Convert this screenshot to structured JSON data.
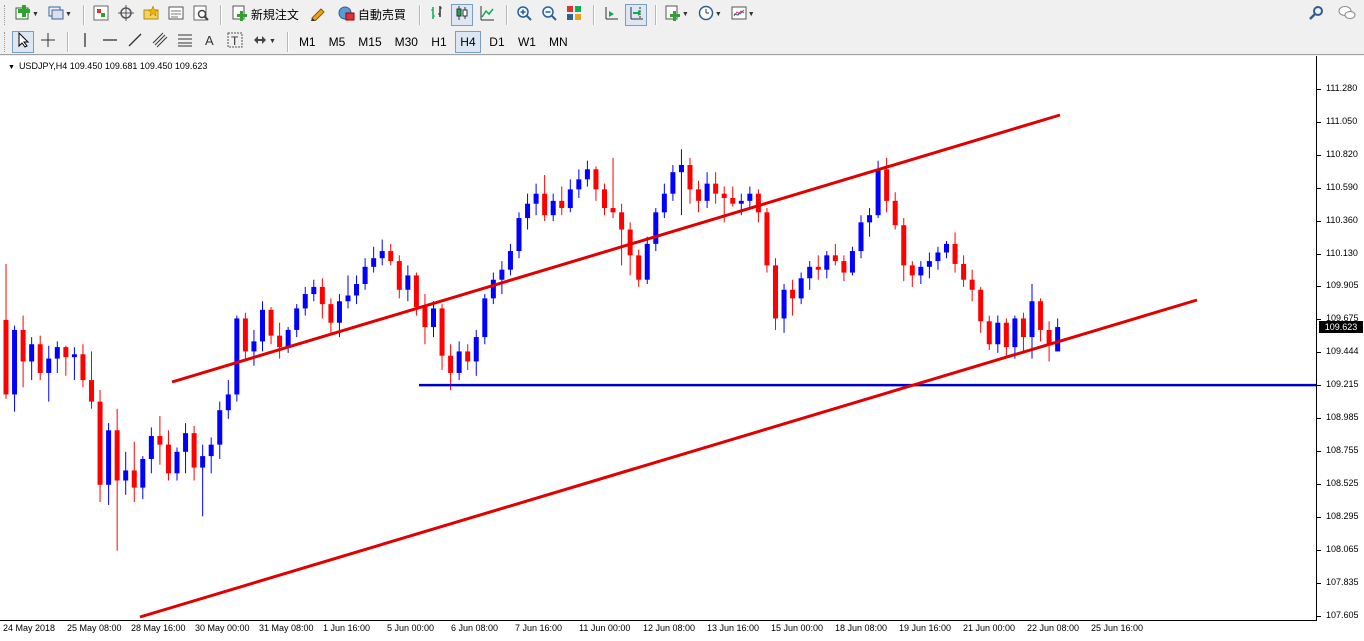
{
  "toolbar_main": {
    "new_order_label": "新規注文",
    "auto_trade_label": "自動売買"
  },
  "toolbar_timeframes": [
    "M1",
    "M5",
    "M15",
    "M30",
    "H1",
    "H4",
    "D1",
    "W1",
    "MN"
  ],
  "active_timeframe": "H4",
  "chart": {
    "header": "USDJPY,H4  109.450 109.681 109.450 109.623",
    "current_price": "109.623",
    "colors": {
      "bull": "#0000ff",
      "bear": "#ff0000",
      "channel": "#e00000",
      "support": "#0000cc"
    }
  },
  "chart_data": {
    "type": "candlestick",
    "symbol": "USDJPY",
    "timeframe": "H4",
    "ohlc_last": {
      "open": 109.45,
      "high": 109.681,
      "low": 109.45,
      "close": 109.623
    },
    "y_ticks": [
      "111.280",
      "111.050",
      "110.820",
      "110.590",
      "110.360",
      "110.130",
      "109.905",
      "109.675",
      "109.444",
      "109.215",
      "108.985",
      "108.755",
      "108.525",
      "108.295",
      "108.065",
      "107.835",
      "107.605"
    ],
    "x_ticks": [
      "24 May 2018",
      "25 May 08:00",
      "28 May 16:00",
      "30 May 00:00",
      "31 May 08:00",
      "1 Jun 16:00",
      "5 Jun 00:00",
      "6 Jun 08:00",
      "7 Jun 16:00",
      "11 Jun 00:00",
      "12 Jun 08:00",
      "13 Jun 16:00",
      "15 Jun 00:00",
      "18 Jun 08:00",
      "19 Jun 16:00",
      "21 Jun 00:00",
      "22 Jun 08:00",
      "25 Jun 16:00"
    ],
    "ylim": [
      107.55,
      111.45
    ],
    "horizontal_support": 109.215,
    "channel_upper": {
      "from": [
        "28 May 16:00",
        109.65
      ],
      "to": [
        "13 Jun 16:00 +",
        111.35
      ]
    },
    "channel_lower": {
      "from": [
        "28 May 16:00",
        108.0
      ],
      "to": [
        "25 Jun 16:00 +",
        110.15
      ]
    },
    "candles": [
      [
        109.67,
        110.06,
        109.12,
        109.15
      ],
      [
        109.15,
        109.63,
        109.03,
        109.6
      ],
      [
        109.6,
        109.7,
        109.2,
        109.38
      ],
      [
        109.38,
        109.55,
        109.25,
        109.5
      ],
      [
        109.5,
        109.56,
        109.25,
        109.3
      ],
      [
        109.3,
        109.49,
        109.1,
        109.4
      ],
      [
        109.4,
        109.52,
        109.3,
        109.48
      ],
      [
        109.48,
        109.49,
        109.28,
        109.41
      ],
      [
        109.41,
        109.48,
        109.25,
        109.43
      ],
      [
        109.43,
        109.5,
        109.2,
        109.25
      ],
      [
        109.25,
        109.45,
        109.05,
        109.1
      ],
      [
        109.1,
        109.18,
        108.4,
        108.52
      ],
      [
        108.52,
        108.95,
        108.38,
        108.9
      ],
      [
        108.9,
        109.05,
        108.06,
        108.55
      ],
      [
        108.55,
        108.75,
        108.45,
        108.62
      ],
      [
        108.62,
        108.82,
        108.4,
        108.5
      ],
      [
        108.5,
        108.72,
        108.42,
        108.7
      ],
      [
        108.7,
        108.92,
        108.6,
        108.86
      ],
      [
        108.86,
        109.0,
        108.66,
        108.8
      ],
      [
        108.8,
        108.9,
        108.55,
        108.6
      ],
      [
        108.6,
        108.78,
        108.55,
        108.75
      ],
      [
        108.75,
        108.95,
        108.6,
        108.88
      ],
      [
        108.88,
        108.93,
        108.55,
        108.64
      ],
      [
        108.64,
        108.8,
        108.3,
        108.72
      ],
      [
        108.72,
        108.85,
        108.6,
        108.8
      ],
      [
        108.8,
        109.1,
        108.7,
        109.04
      ],
      [
        109.04,
        109.25,
        108.98,
        109.15
      ],
      [
        109.15,
        109.7,
        109.1,
        109.68
      ],
      [
        109.68,
        109.72,
        109.38,
        109.45
      ],
      [
        109.45,
        109.6,
        109.35,
        109.52
      ],
      [
        109.52,
        109.8,
        109.45,
        109.74
      ],
      [
        109.74,
        109.76,
        109.5,
        109.56
      ],
      [
        109.56,
        109.65,
        109.4,
        109.48
      ],
      [
        109.48,
        109.62,
        109.44,
        109.6
      ],
      [
        109.6,
        109.78,
        109.55,
        109.75
      ],
      [
        109.75,
        109.9,
        109.7,
        109.85
      ],
      [
        109.85,
        109.95,
        109.8,
        109.9
      ],
      [
        109.9,
        109.96,
        109.68,
        109.78
      ],
      [
        109.78,
        109.82,
        109.58,
        109.65
      ],
      [
        109.65,
        109.85,
        109.55,
        109.8
      ],
      [
        109.8,
        109.98,
        109.75,
        109.84
      ],
      [
        109.84,
        109.98,
        109.78,
        109.92
      ],
      [
        109.92,
        110.1,
        109.88,
        110.04
      ],
      [
        110.04,
        110.18,
        110.0,
        110.1
      ],
      [
        110.1,
        110.23,
        110.05,
        110.15
      ],
      [
        110.15,
        110.2,
        110.05,
        110.08
      ],
      [
        110.08,
        110.12,
        109.82,
        109.88
      ],
      [
        109.88,
        110.05,
        109.8,
        109.98
      ],
      [
        109.98,
        110.0,
        109.7,
        109.76
      ],
      [
        109.76,
        109.85,
        109.5,
        109.62
      ],
      [
        109.62,
        109.8,
        109.55,
        109.75
      ],
      [
        109.75,
        109.78,
        109.32,
        109.42
      ],
      [
        109.42,
        109.5,
        109.18,
        109.3
      ],
      [
        109.3,
        109.52,
        109.25,
        109.45
      ],
      [
        109.45,
        109.5,
        109.32,
        109.38
      ],
      [
        109.38,
        109.6,
        109.28,
        109.55
      ],
      [
        109.55,
        109.85,
        109.5,
        109.82
      ],
      [
        109.82,
        110.0,
        109.78,
        109.95
      ],
      [
        109.95,
        110.08,
        109.85,
        110.02
      ],
      [
        110.02,
        110.2,
        109.98,
        110.15
      ],
      [
        110.15,
        110.42,
        110.1,
        110.38
      ],
      [
        110.38,
        110.55,
        110.3,
        110.48
      ],
      [
        110.48,
        110.62,
        110.4,
        110.55
      ],
      [
        110.55,
        110.68,
        110.36,
        110.4
      ],
      [
        110.4,
        110.55,
        110.36,
        110.5
      ],
      [
        110.5,
        110.6,
        110.4,
        110.45
      ],
      [
        110.45,
        110.65,
        110.42,
        110.58
      ],
      [
        110.58,
        110.72,
        110.52,
        110.65
      ],
      [
        110.65,
        110.78,
        110.6,
        110.72
      ],
      [
        110.72,
        110.74,
        110.5,
        110.58
      ],
      [
        110.58,
        110.62,
        110.4,
        110.45
      ],
      [
        110.45,
        110.8,
        110.38,
        110.42
      ],
      [
        110.42,
        110.48,
        110.05,
        110.3
      ],
      [
        110.3,
        110.35,
        109.98,
        110.12
      ],
      [
        110.12,
        110.16,
        109.9,
        109.95
      ],
      [
        109.95,
        110.25,
        109.92,
        110.2
      ],
      [
        110.2,
        110.45,
        110.15,
        110.42
      ],
      [
        110.42,
        110.62,
        110.38,
        110.55
      ],
      [
        110.55,
        110.75,
        110.5,
        110.7
      ],
      [
        110.7,
        110.86,
        110.4,
        110.75
      ],
      [
        110.75,
        110.8,
        110.48,
        110.58
      ],
      [
        110.58,
        110.64,
        110.42,
        110.5
      ],
      [
        110.5,
        110.7,
        110.45,
        110.62
      ],
      [
        110.62,
        110.7,
        110.48,
        110.55
      ],
      [
        110.55,
        110.6,
        110.35,
        110.52
      ],
      [
        110.52,
        110.6,
        110.46,
        110.48
      ],
      [
        110.48,
        110.55,
        110.4,
        110.5
      ],
      [
        110.5,
        110.6,
        110.45,
        110.55
      ],
      [
        110.55,
        110.58,
        110.35,
        110.42
      ],
      [
        110.42,
        110.45,
        110.0,
        110.05
      ],
      [
        110.05,
        110.1,
        109.6,
        109.68
      ],
      [
        109.68,
        109.92,
        109.58,
        109.88
      ],
      [
        109.88,
        109.95,
        109.7,
        109.82
      ],
      [
        109.82,
        110.0,
        109.78,
        109.96
      ],
      [
        109.96,
        110.08,
        109.88,
        110.04
      ],
      [
        110.04,
        110.12,
        109.95,
        110.02
      ],
      [
        110.02,
        110.15,
        109.96,
        110.12
      ],
      [
        110.12,
        110.2,
        110.05,
        110.08
      ],
      [
        110.08,
        110.12,
        109.94,
        110.0
      ],
      [
        110.0,
        110.18,
        109.98,
        110.15
      ],
      [
        110.15,
        110.4,
        110.1,
        110.35
      ],
      [
        110.35,
        110.45,
        110.25,
        110.4
      ],
      [
        110.4,
        110.78,
        110.38,
        110.72
      ],
      [
        110.72,
        110.8,
        110.42,
        110.5
      ],
      [
        110.5,
        110.56,
        110.3,
        110.33
      ],
      [
        110.33,
        110.38,
        109.94,
        110.05
      ],
      [
        110.05,
        110.08,
        109.9,
        109.98
      ],
      [
        109.98,
        110.08,
        109.92,
        110.04
      ],
      [
        110.04,
        110.14,
        109.96,
        110.08
      ],
      [
        110.08,
        110.18,
        110.02,
        110.14
      ],
      [
        110.14,
        110.22,
        110.1,
        110.2
      ],
      [
        110.2,
        110.28,
        110.0,
        110.06
      ],
      [
        110.06,
        110.12,
        109.9,
        109.95
      ],
      [
        109.95,
        110.02,
        109.8,
        109.88
      ],
      [
        109.88,
        109.9,
        109.58,
        109.66
      ],
      [
        109.66,
        109.7,
        109.46,
        109.5
      ],
      [
        109.5,
        109.7,
        109.44,
        109.65
      ],
      [
        109.65,
        109.68,
        109.42,
        109.48
      ],
      [
        109.48,
        109.7,
        109.4,
        109.68
      ],
      [
        109.68,
        109.72,
        109.44,
        109.55
      ],
      [
        109.55,
        109.92,
        109.4,
        109.8
      ],
      [
        109.8,
        109.82,
        109.52,
        109.6
      ],
      [
        109.6,
        109.66,
        109.38,
        109.5
      ],
      [
        109.45,
        109.68,
        109.45,
        109.62
      ]
    ]
  }
}
